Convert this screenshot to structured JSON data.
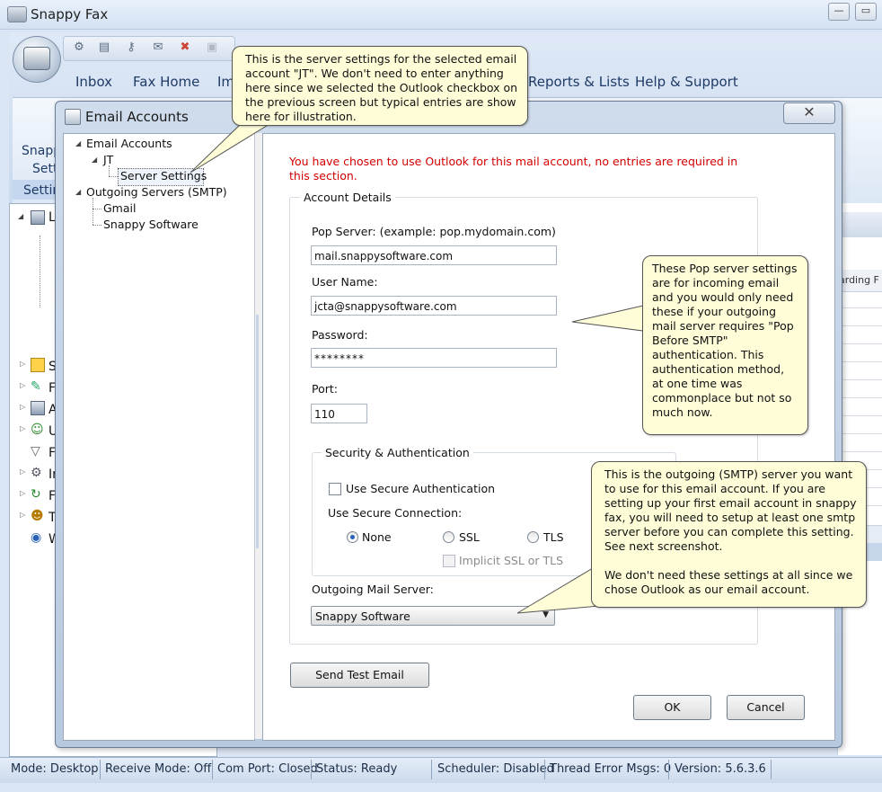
{
  "app": {
    "title": "Snappy Fax",
    "min_glyph": "—",
    "max_glyph": "▭"
  },
  "ribbon": {
    "tabs": [
      "Inbox",
      "Fax Home",
      "Im",
      "Reports & Lists",
      "Help & Support"
    ],
    "group_fragment_1": "Snapp",
    "group_fragment_2": "Sett",
    "group_fragment_3": "Settin"
  },
  "dialog": {
    "title": "Email Accounts",
    "close_glyph": "✕",
    "tree": {
      "email_accounts": "Email Accounts",
      "jt": "JT",
      "server_settings": "Server Settings",
      "outgoing_servers": "Outgoing Servers (SMTP)",
      "gmail": "Gmail",
      "snappy_software": "Snappy Software"
    },
    "outlook_notice": "You have chosen to use Outlook for this mail account, no entries are required in this section.",
    "account_details": {
      "legend": "Account Details",
      "pop_label": "Pop Server: (example: pop.mydomain.com)",
      "pop_value": "mail.snappysoftware.com",
      "user_label": "User Name:",
      "user_value": "jcta@snappysoftware.com",
      "password_label": "Password:",
      "password_value": "********",
      "port_label": "Port:",
      "port_value": "110"
    },
    "security": {
      "legend": "Security & Authentication",
      "use_secure_auth": "Use Secure Authentication",
      "use_secure_connection": "Use Secure Connection:",
      "none": "None",
      "ssl": "SSL",
      "tls": "TLS",
      "implicit": "Implicit SSL or TLS"
    },
    "outgoing": {
      "label": "Outgoing Mail Server:",
      "value": "Snappy Software"
    },
    "buttons": {
      "send_test": "Send Test Email",
      "ok": "OK",
      "cancel": "Cancel"
    }
  },
  "callouts": {
    "top": "This is the server settings for the selected email account \"JT\".  We don't need to enter anything here since we selected the Outlook checkbox on the previous screen but typical entries are show here for illustration.",
    "pop": "These Pop server settings are for incoming email and you would only need these if your outgoing mail server requires \"Pop Before SMTP\" authentication.  This authentication method, at one time was commonplace but not so much now.",
    "smtp_1": "This is the outgoing (SMTP) server you want to use for this email account.  If you are setting up your first email account in snappy fax, you will need to setup at least one smtp server before you can complete this setting.  See next screenshot.",
    "smtp_2": "We don't need these settings at all since we chose Outlook as our email account."
  },
  "right_pane": {
    "header_fragment": "arding F"
  },
  "statusbar": {
    "mode": "Mode: Desktop",
    "receive": "Receive Mode: Off",
    "com": "Com Port: Closed",
    "status": "Status: Ready",
    "scheduler": "Scheduler: Disabled",
    "thread": "Thread Error Msgs: 0",
    "version": "Version: 5.6.3.6"
  },
  "tree_fragments": [
    "L",
    "S",
    "F",
    "A",
    "U",
    "F",
    "In",
    "F",
    "T",
    "W"
  ],
  "colors": {
    "notice_red": "#d40000",
    "callout_bg": "#fefdd8"
  }
}
